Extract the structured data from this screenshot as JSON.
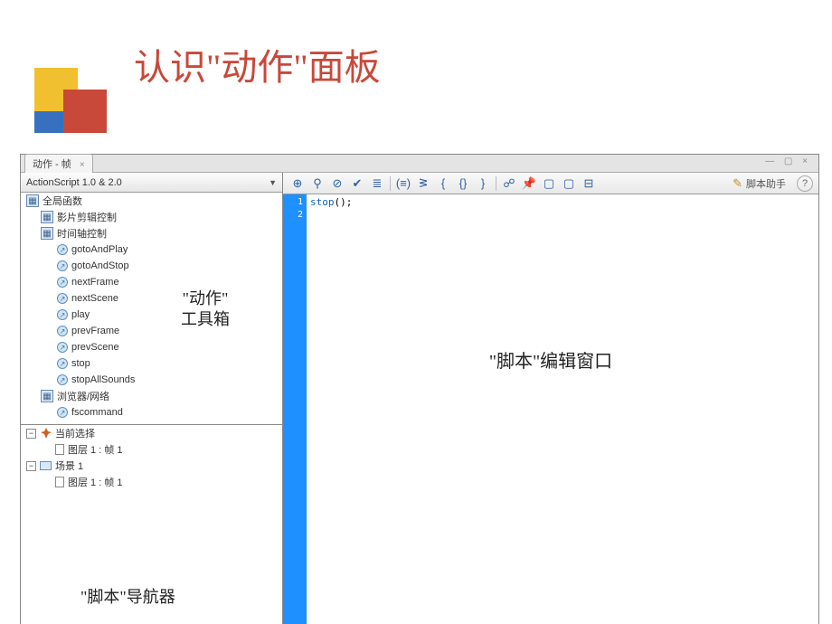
{
  "slide": {
    "title": "认识\"动作\"面板"
  },
  "panel": {
    "tab_label": "动作 - 帧",
    "window_controls": "— ▢ ×"
  },
  "dropdown": {
    "label": "ActionScript 1.0 & 2.0"
  },
  "toolbox": {
    "groups": [
      {
        "label": "全局函数"
      },
      {
        "label": "影片剪辑控制"
      },
      {
        "label": "时间轴控制"
      }
    ],
    "timeline_items": [
      "gotoAndPlay",
      "gotoAndStop",
      "nextFrame",
      "nextScene",
      "play",
      "prevFrame",
      "prevScene",
      "stop",
      "stopAllSounds"
    ],
    "browser_group": "浏览器/网络",
    "browser_items": [
      "fscommand"
    ],
    "annotation_label1": "\"动作\"",
    "annotation_label2": "工具箱"
  },
  "navigator": {
    "current_selection": "当前选择",
    "layer_frame": "图层 1 : 帧 1",
    "scene": "场景 1",
    "annotation_label": "\"脚本\"导航器"
  },
  "toolbar": {
    "icons": [
      "add-icon",
      "find-icon",
      "target-icon",
      "check-icon",
      "format-icon",
      "autoformat-icon",
      "debug-icon",
      "brace-left-icon",
      "brace-pair-icon",
      "brace-right-icon",
      "comment-icon",
      "pin-icon",
      "snippet-icon",
      "snippet2-icon",
      "collapse-icon"
    ],
    "glyphs": [
      "⊕",
      "⚲",
      "⊘",
      "✔",
      "≣",
      "(≡)",
      "ᕒ",
      "{",
      "{}",
      "}",
      "☍",
      "📌",
      "▢",
      "▢",
      "⊟"
    ],
    "script_assist": "脚本助手",
    "help": "?"
  },
  "code": {
    "line_numbers": [
      "1",
      "2"
    ],
    "line1_kw": "stop",
    "line1_rest": "();"
  },
  "editor_label": "\"脚本\"编辑窗口"
}
